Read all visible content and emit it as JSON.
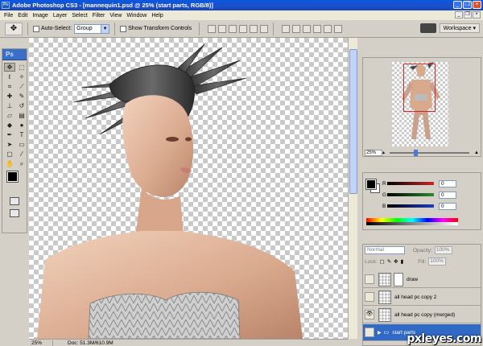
{
  "window": {
    "title": "Adobe Photoshop CS3 - [mannequin1.psd @ 25% (start parts, RGB/8)]",
    "app_icon": "Ps"
  },
  "menu": [
    "File",
    "Edit",
    "Image",
    "Layer",
    "Select",
    "Filter",
    "View",
    "Window",
    "Help"
  ],
  "options_bar": {
    "auto_select_label": "Auto-Select:",
    "auto_select_checked": false,
    "auto_select_value": "Group",
    "show_transform_label": "Show Transform Controls",
    "show_transform_checked": false,
    "workspace_label": "Workspace ▾"
  },
  "toolbox": {
    "logo": "Ps",
    "foreground_color": "#000000",
    "background_color": "#ffffff"
  },
  "canvas": {
    "zoom": "25%",
    "doc_info": "Doc: 51.3M/610.9M"
  },
  "navigator": {
    "zoom": "25%"
  },
  "color_panel": {
    "channels": [
      {
        "name": "R",
        "value": "0"
      },
      {
        "name": "G",
        "value": "0"
      },
      {
        "name": "B",
        "value": "0"
      }
    ],
    "colors": {
      "r_bar": "#c62828",
      "g_bar": "#2e8b2e",
      "b_bar": "#1d3fbf"
    }
  },
  "layers_panel": {
    "blend_mode": "Normal",
    "opacity_label": "Opacity:",
    "opacity_value": "100%",
    "lock_label": "Lock:",
    "fill_label": "Fill:",
    "fill_value": "100%",
    "layers": [
      {
        "name": "draw",
        "visible": false,
        "has_mask": true,
        "selected": false
      },
      {
        "name": "all head pc copy 2",
        "visible": false,
        "has_mask": false,
        "selected": false
      },
      {
        "name": "all head pc copy (merged)",
        "visible": true,
        "has_mask": false,
        "selected": false
      },
      {
        "name": "start parts",
        "visible": false,
        "has_mask": false,
        "selected": true
      }
    ]
  },
  "watermark": "pxleyes.com"
}
